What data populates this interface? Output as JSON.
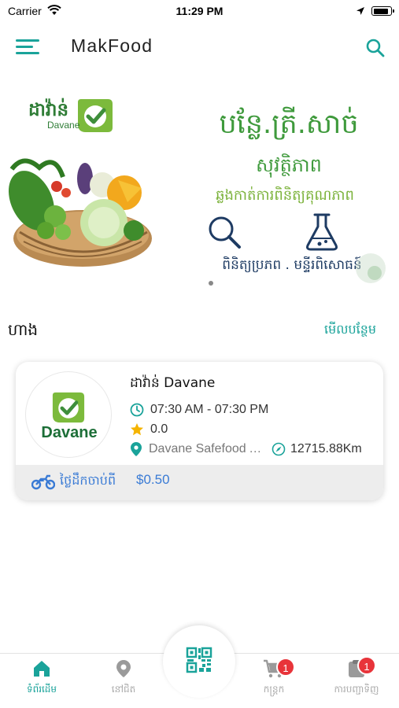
{
  "status_bar": {
    "carrier": "Carrier",
    "time": "11:29 PM",
    "battery_level": 0.9
  },
  "app_bar": {
    "title": "MakFood",
    "menu_icon": "hamburger-icon",
    "search_icon": "search-icon"
  },
  "banner": {
    "logo_text": "ដាវ៉ាន់",
    "logo_subtext": "Davane",
    "line1": "បន្លែ.ត្រី.សាច់",
    "line2": "សុវត្ថិភាព",
    "line3": "ឆ្លងកាត់ការពិនិត្យគុណភាព",
    "line4": "ពិនិត្យប្រភព . មន្ទីរពិសោធន៍",
    "colors": {
      "green": "#3f9a3c",
      "lime": "#7bb23a",
      "navy": "#1e3b63"
    }
  },
  "section": {
    "title": "ហាង",
    "more_link": "មើលបន្ថែម"
  },
  "store": {
    "name": "ដាវ៉ាន់ Davane",
    "logo_name": "Davane",
    "hours": "07:30 AM - 07:30 PM",
    "rating": "0.0",
    "address": "Davane Safefood Acceptance",
    "distance": "12715.88Km",
    "delivery_label": "ថ្លៃដឹកចាប់ពី",
    "delivery_fee": "$0.50"
  },
  "tabs": [
    {
      "label": "ទំព័រដើម",
      "icon": "home-icon",
      "active": true
    },
    {
      "label": "នៅជិត",
      "icon": "location-pin-icon",
      "active": false
    },
    {
      "label": "",
      "icon": "qr-code-icon",
      "active": false
    },
    {
      "label": "កន្ត្រក",
      "icon": "cart-icon",
      "badge": "1",
      "active": false
    },
    {
      "label": "ការបញ្ជាទិញ",
      "icon": "orders-icon",
      "badge": "1",
      "active": false
    }
  ],
  "accent_color": "#1aa39a"
}
